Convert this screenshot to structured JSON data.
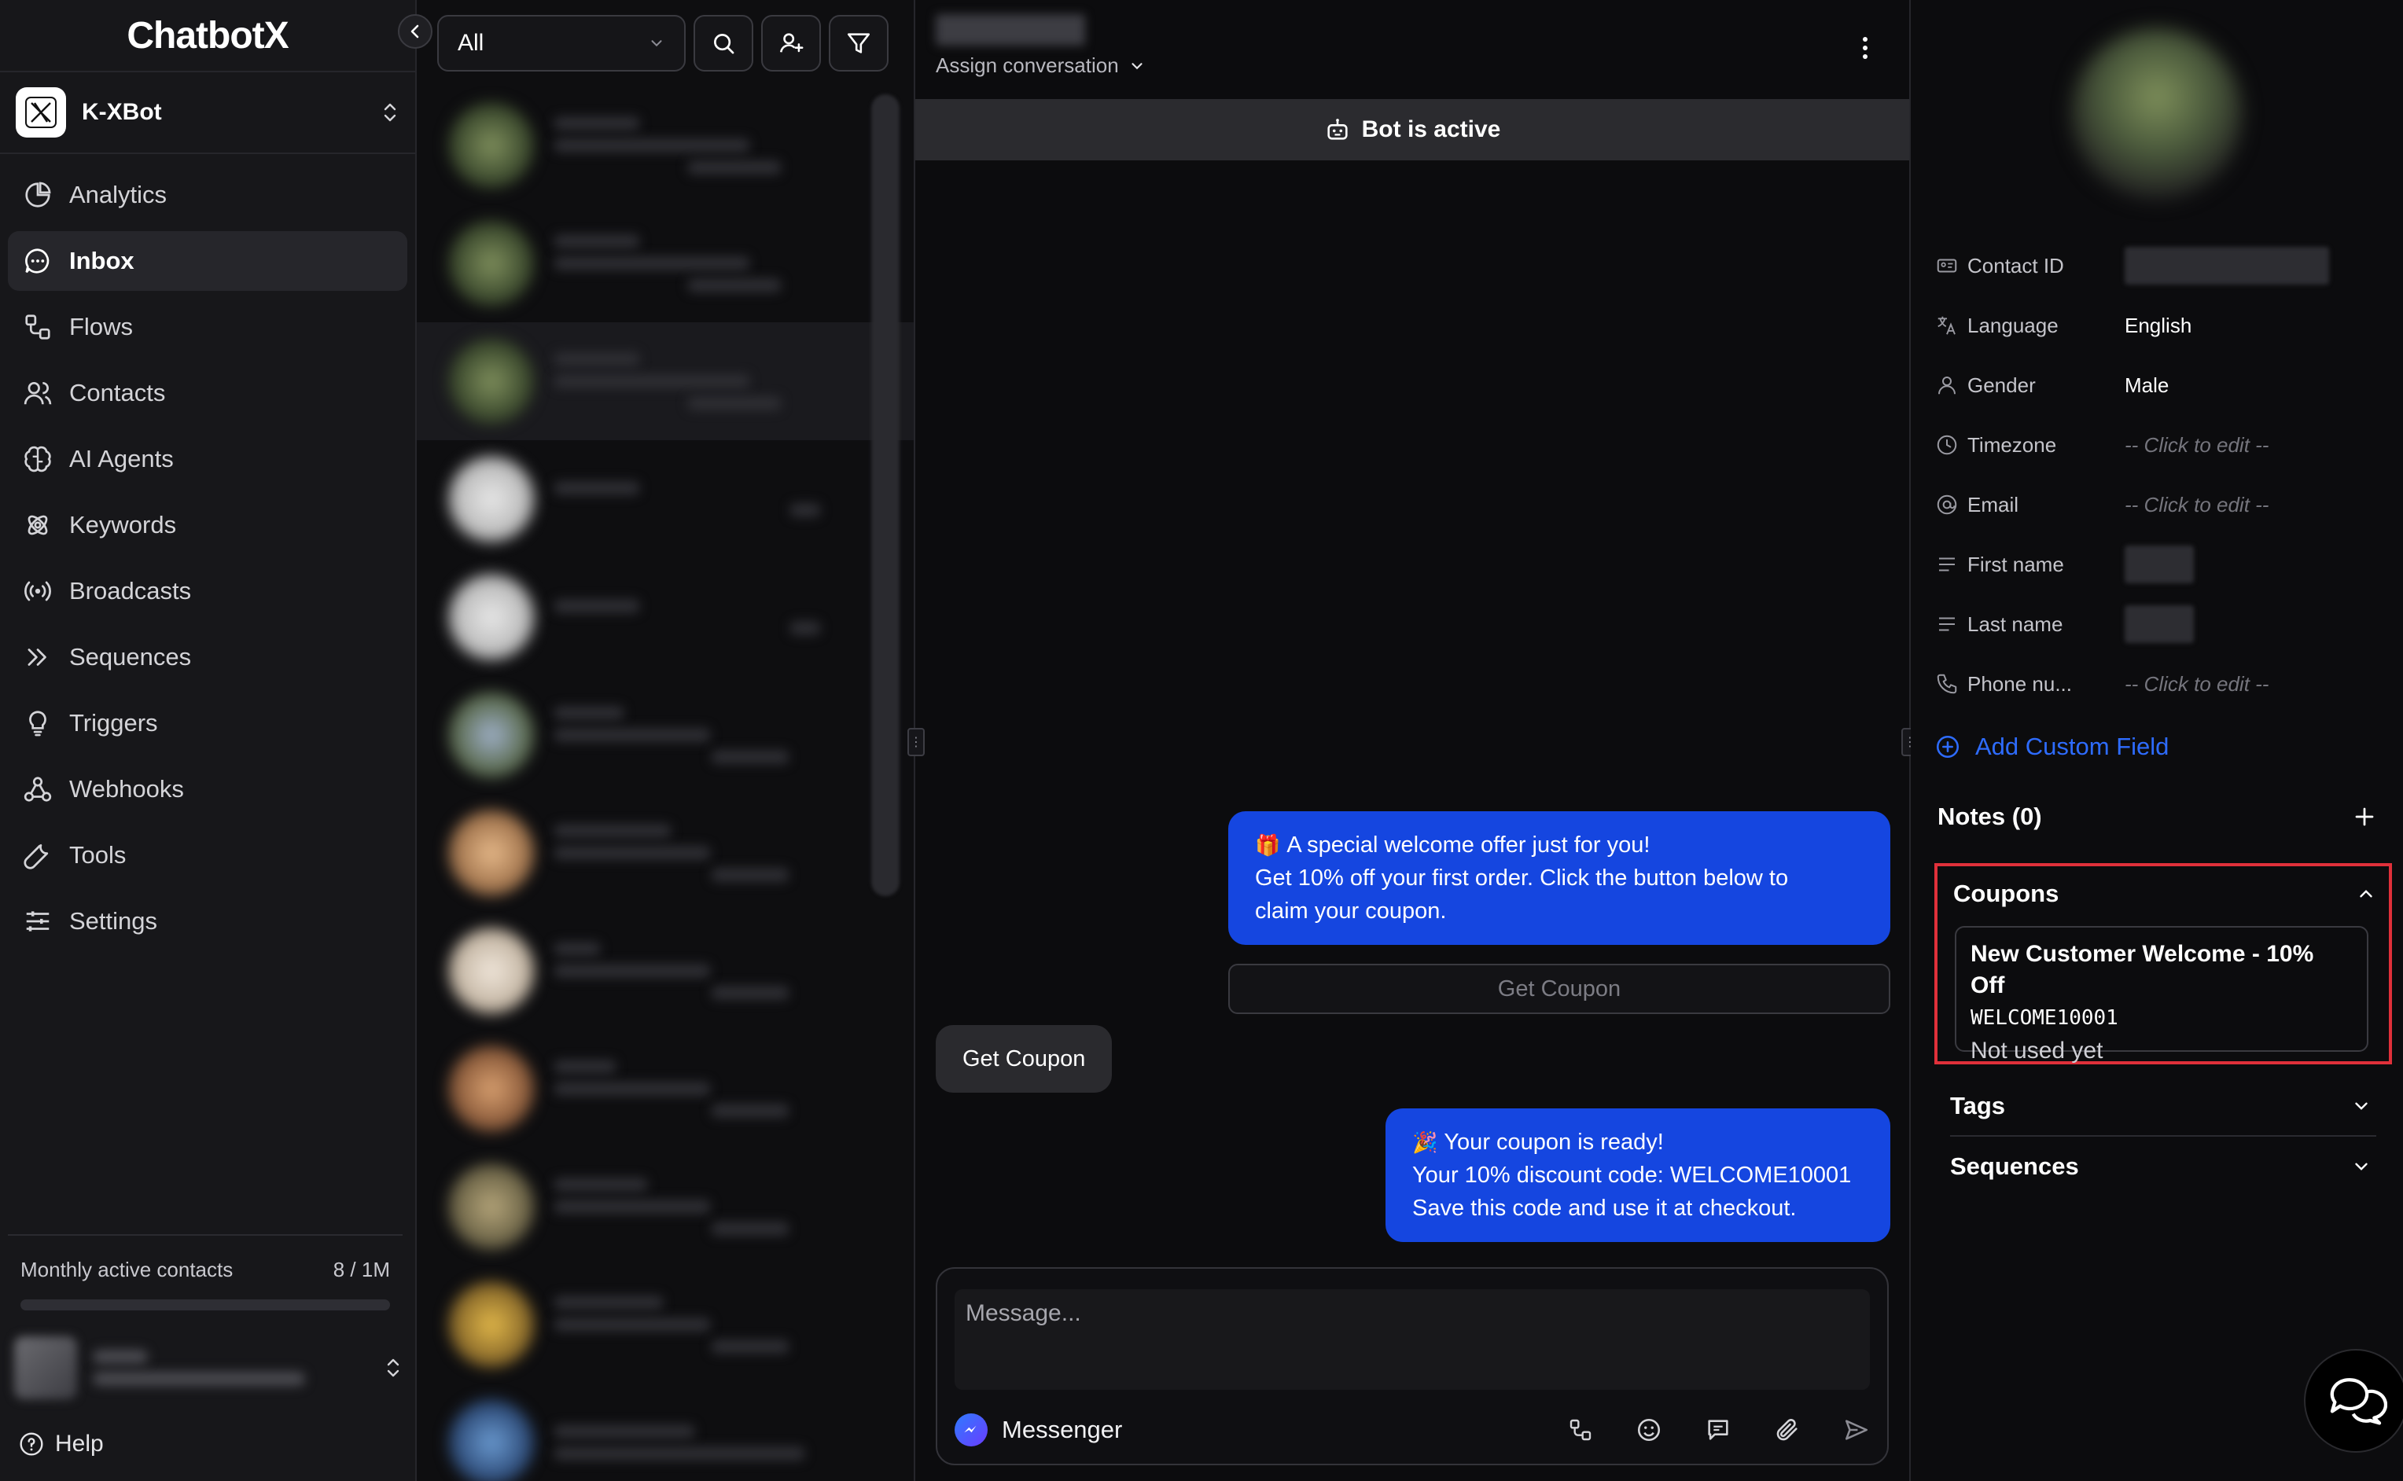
{
  "app": {
    "logo": "ChatbotX"
  },
  "bot": {
    "name": "K-XBot"
  },
  "nav": [
    {
      "label": "Analytics",
      "icon": "analytics-icon",
      "active": false
    },
    {
      "label": "Inbox",
      "icon": "inbox-icon",
      "active": true
    },
    {
      "label": "Flows",
      "icon": "flows-icon",
      "active": false
    },
    {
      "label": "Contacts",
      "icon": "contacts-icon",
      "active": false
    },
    {
      "label": "AI Agents",
      "icon": "brain-icon",
      "active": false
    },
    {
      "label": "Keywords",
      "icon": "keywords-icon",
      "active": false
    },
    {
      "label": "Broadcasts",
      "icon": "broadcast-icon",
      "active": false
    },
    {
      "label": "Sequences",
      "icon": "sequences-icon",
      "active": false
    },
    {
      "label": "Triggers",
      "icon": "lightbulb-icon",
      "active": false
    },
    {
      "label": "Webhooks",
      "icon": "webhook-icon",
      "active": false
    },
    {
      "label": "Tools",
      "icon": "wrench-icon",
      "active": false
    },
    {
      "label": "Settings",
      "icon": "sliders-icon",
      "active": false
    }
  ],
  "usage": {
    "label": "Monthly active contacts",
    "value": "8 / 1M",
    "fraction": 8e-06
  },
  "help": {
    "label": "Help"
  },
  "list": {
    "filter_value": "All"
  },
  "chat": {
    "assign_label": "Assign conversation",
    "bot_status": "Bot is active",
    "messages": {
      "welcome_line1": "A special welcome offer just for you!",
      "welcome_line2": "Get 10% off your first order. Click the button below to",
      "welcome_line3": "claim your coupon.",
      "welcome_button": "Get Coupon",
      "user_reply": "Get Coupon",
      "ready_line1": "Your coupon is ready!",
      "ready_line2": "Your 10% discount code: WELCOME10001",
      "ready_line3": "Save this code and use it at checkout."
    },
    "composer": {
      "placeholder": "Message...",
      "channel": "Messenger"
    }
  },
  "contact": {
    "fields": [
      {
        "label": "Contact ID",
        "icon": "id-card-icon",
        "value": "",
        "type": "blurred"
      },
      {
        "label": "Language",
        "icon": "translate-icon",
        "value": "English",
        "type": "value"
      },
      {
        "label": "Gender",
        "icon": "user-icon",
        "value": "Male",
        "type": "value"
      },
      {
        "label": "Timezone",
        "icon": "clock-icon",
        "value": "-- Click to edit --",
        "type": "placeholder"
      },
      {
        "label": "Email",
        "icon": "at-icon",
        "value": "-- Click to edit --",
        "type": "placeholder"
      },
      {
        "label": "First name",
        "icon": "text-lines-icon",
        "value": "",
        "type": "blurred"
      },
      {
        "label": "Last name",
        "icon": "text-lines-icon",
        "value": "",
        "type": "blurred"
      },
      {
        "label": "Phone nu...",
        "icon": "phone-icon",
        "value": "-- Click to edit --",
        "type": "placeholder"
      }
    ],
    "add_field_label": "Add Custom Field",
    "notes_label": "Notes (0)",
    "coupons": {
      "title": "Coupons",
      "coupon_name": "New Customer Welcome - 10% Off",
      "coupon_code": "WELCOME10001",
      "coupon_status": "Not used yet"
    },
    "tags_label": "Tags",
    "sequences_label": "Sequences"
  },
  "colors": {
    "accent": "#1546e0",
    "link": "#2e6cff",
    "highlight": "#e0303a",
    "bg": "#0d0d0f"
  }
}
